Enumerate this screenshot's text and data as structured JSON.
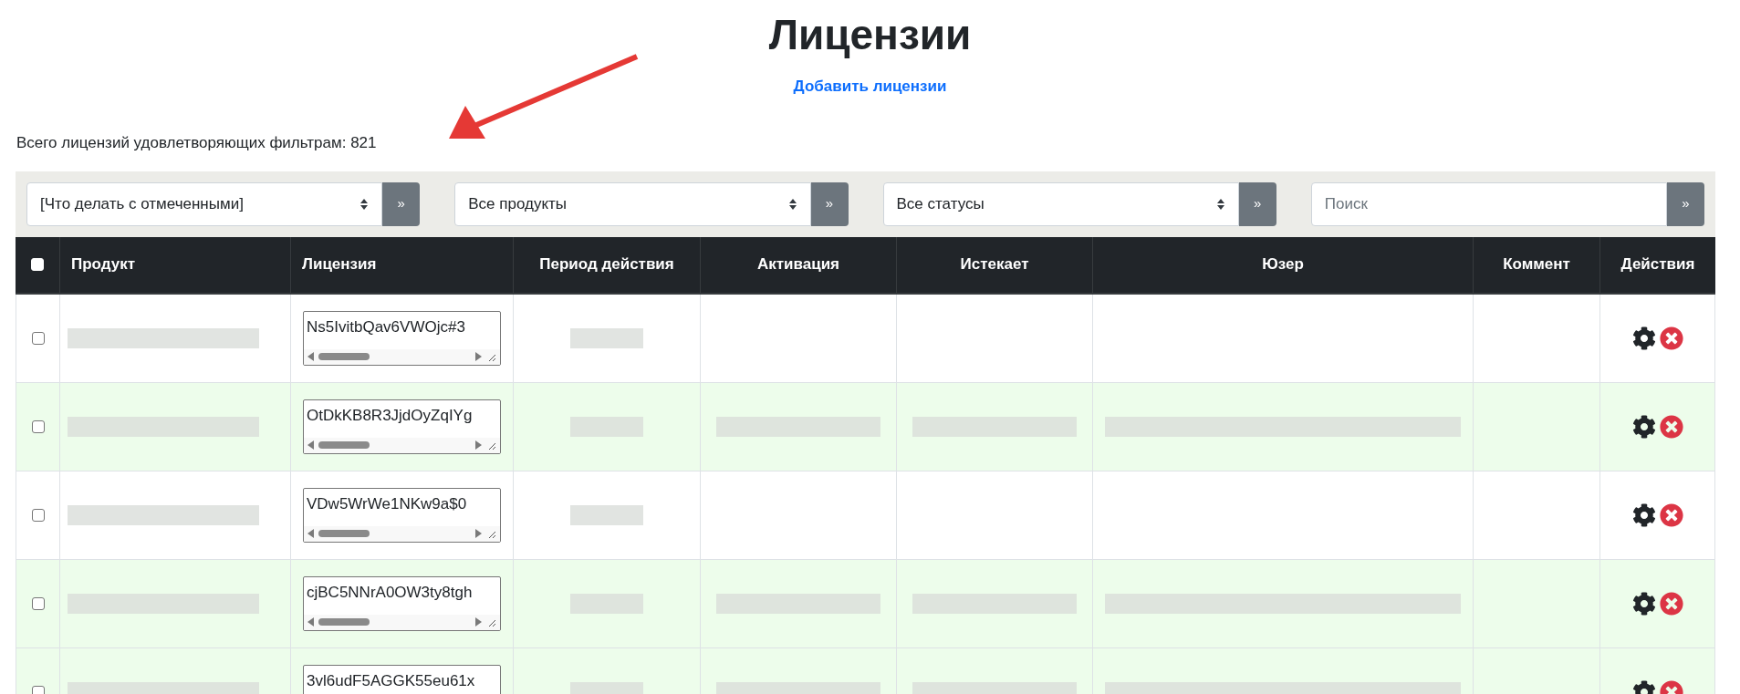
{
  "title": "Лицензии",
  "add_link": "Добавить лицензии",
  "total": "Всего лицензий удовлетворяющих фильтрам: 821",
  "filters": [
    {
      "kind": "select",
      "value": "[Что делать с отмеченными]",
      "button": "»"
    },
    {
      "kind": "select",
      "value": "Все продукты",
      "button": "»"
    },
    {
      "kind": "select",
      "value": "Все статусы",
      "button": "»"
    },
    {
      "kind": "search",
      "placeholder": "Поиск",
      "button": "»"
    }
  ],
  "table": {
    "select_all": {
      "checked": false
    },
    "columns": [
      "Продукт",
      "Лицензия",
      "Период действия",
      "Активация",
      "Истекает",
      "Юзер",
      "Коммент",
      "Действия"
    ],
    "rows": [
      {
        "checked": false,
        "highlighted": false,
        "license": "Ns5IvitbQav6VWOjc#3",
        "redacted": {
          "product": true,
          "period": true,
          "activation": false,
          "expires": false,
          "user": false
        }
      },
      {
        "checked": false,
        "highlighted": true,
        "license": "OtDkKB8R3JjdOyZqIYg",
        "redacted": {
          "product": true,
          "period": true,
          "activation": true,
          "expires": true,
          "user": true
        }
      },
      {
        "checked": false,
        "highlighted": false,
        "license": "VDw5WrWe1NKw9a$0",
        "redacted": {
          "product": true,
          "period": true,
          "activation": false,
          "expires": false,
          "user": false
        }
      },
      {
        "checked": false,
        "highlighted": true,
        "license": "cjBC5NNrA0OW3ty8tgh",
        "redacted": {
          "product": true,
          "period": true,
          "activation": true,
          "expires": true,
          "user": true
        }
      },
      {
        "checked": false,
        "highlighted": true,
        "license": "3vl6udF5AGGK55eu61x",
        "redacted": {
          "product": true,
          "period": true,
          "activation": true,
          "expires": true,
          "user": true
        }
      }
    ]
  }
}
